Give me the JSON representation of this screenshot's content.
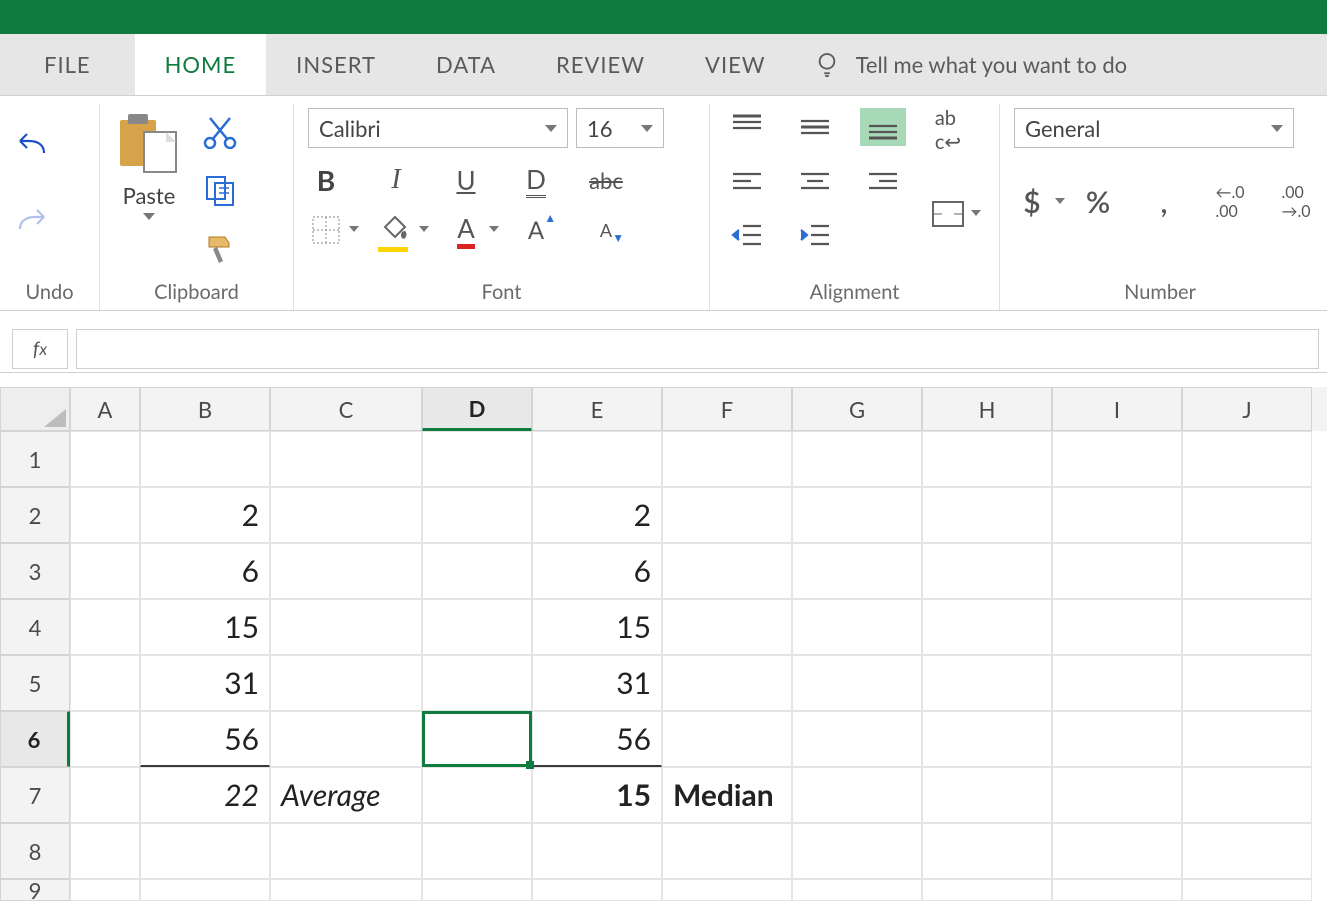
{
  "tabs": {
    "file": "FILE",
    "home": "HOME",
    "insert": "INSERT",
    "data": "DATA",
    "review": "REVIEW",
    "view": "VIEW",
    "tellme": "Tell me what you want to do"
  },
  "ribbon": {
    "undo_group": "Undo",
    "clipboard_group": "Clipboard",
    "paste_label": "Paste",
    "font_group": "Font",
    "font_name": "Calibri",
    "font_size": "16",
    "alignment_group": "Alignment",
    "number_group": "Number",
    "number_format": "General"
  },
  "col_headers": [
    "A",
    "B",
    "C",
    "D",
    "E",
    "F",
    "G",
    "H",
    "I",
    "J"
  ],
  "row_headers": [
    "1",
    "2",
    "3",
    "4",
    "5",
    "6",
    "7",
    "8",
    "9"
  ],
  "cells": {
    "B2": "2",
    "E2": "2",
    "B3": "6",
    "E3": "6",
    "B4": "15",
    "E4": "15",
    "B5": "31",
    "E5": "31",
    "B6": "56",
    "E6": "56",
    "B7": "22",
    "C7": "Average",
    "E7": "15",
    "F7": "Median"
  },
  "active_cell": "D6",
  "chart_data": {
    "type": "table",
    "title": "",
    "series": [
      {
        "name": "B",
        "values": [
          2,
          6,
          15,
          31,
          56
        ]
      },
      {
        "name": "E",
        "values": [
          2,
          6,
          15,
          31,
          56
        ]
      }
    ],
    "summary": {
      "B7_Average": 22,
      "E7_Median": 15
    }
  }
}
